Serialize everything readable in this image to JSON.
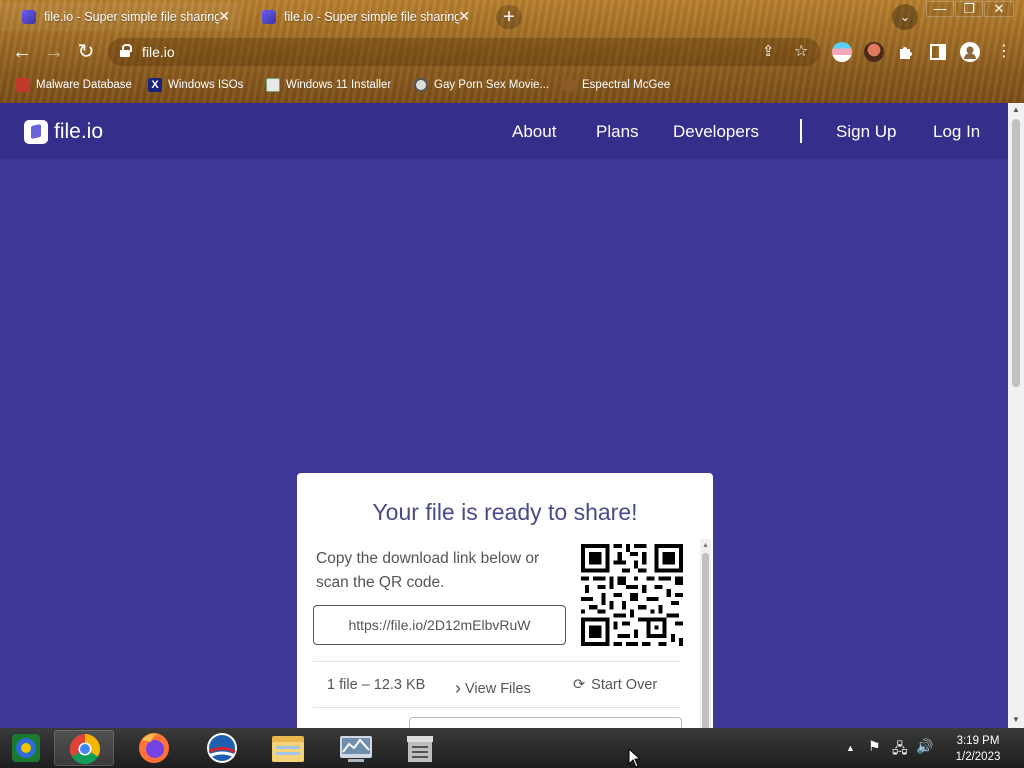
{
  "browser": {
    "tabs": [
      {
        "title": "file.io - Super simple file sharing",
        "close": "✕",
        "active": true
      },
      {
        "title": "file.io - Super simple file sharing",
        "close": "✕",
        "active": false
      }
    ],
    "new_tab": "+",
    "tab_search": "⌄",
    "window_controls": {
      "minimize": "—",
      "restore": "❐",
      "close": "✕"
    },
    "nav": {
      "back": "←",
      "forward": "→",
      "reload": "↻"
    },
    "url": "file.io",
    "share_icon": "⇪",
    "star_icon": "☆",
    "bookmarks": [
      {
        "label": "Malware Database",
        "icon_color": "#c0392b"
      },
      {
        "label": "Windows ISOs",
        "icon_color": "#1a237e"
      },
      {
        "label": "Windows 11 Installer",
        "icon_color": "#7aa37a"
      },
      {
        "label": "Gay Porn Sex Movie...",
        "icon_color": "#555555"
      },
      {
        "label": "Espectral McGee",
        "icon_color": "#8d5a2b"
      }
    ]
  },
  "site": {
    "brand": "file.io",
    "nav": {
      "about": "About",
      "plans": "Plans",
      "developers": "Developers",
      "signup": "Sign Up",
      "login": "Log In"
    },
    "colors": {
      "background": "#3e3699",
      "navbar": "#352e8a"
    }
  },
  "card": {
    "title": "Your file is ready to share!",
    "description": "Copy the download link below or scan the QR code.",
    "link": "https://file.io/2D12mElbvRuW",
    "file_count": "1 file – 12.3 KB",
    "view_files": "View Files",
    "view_files_icon": "›",
    "start_over": "Start Over",
    "start_over_icon": "⟳"
  },
  "taskbar": {
    "apps": [
      {
        "name": "start-button"
      },
      {
        "name": "chrome"
      },
      {
        "name": "firefox"
      },
      {
        "name": "obama-app"
      },
      {
        "name": "file-explorer"
      },
      {
        "name": "system-monitor"
      },
      {
        "name": "archive-app"
      }
    ],
    "clock": {
      "time": "3:19 PM",
      "date": "1/2/2023"
    },
    "tray": {
      "chevron": "▲",
      "flag": "⚑",
      "network": "🖧",
      "volume": "🔊"
    }
  }
}
